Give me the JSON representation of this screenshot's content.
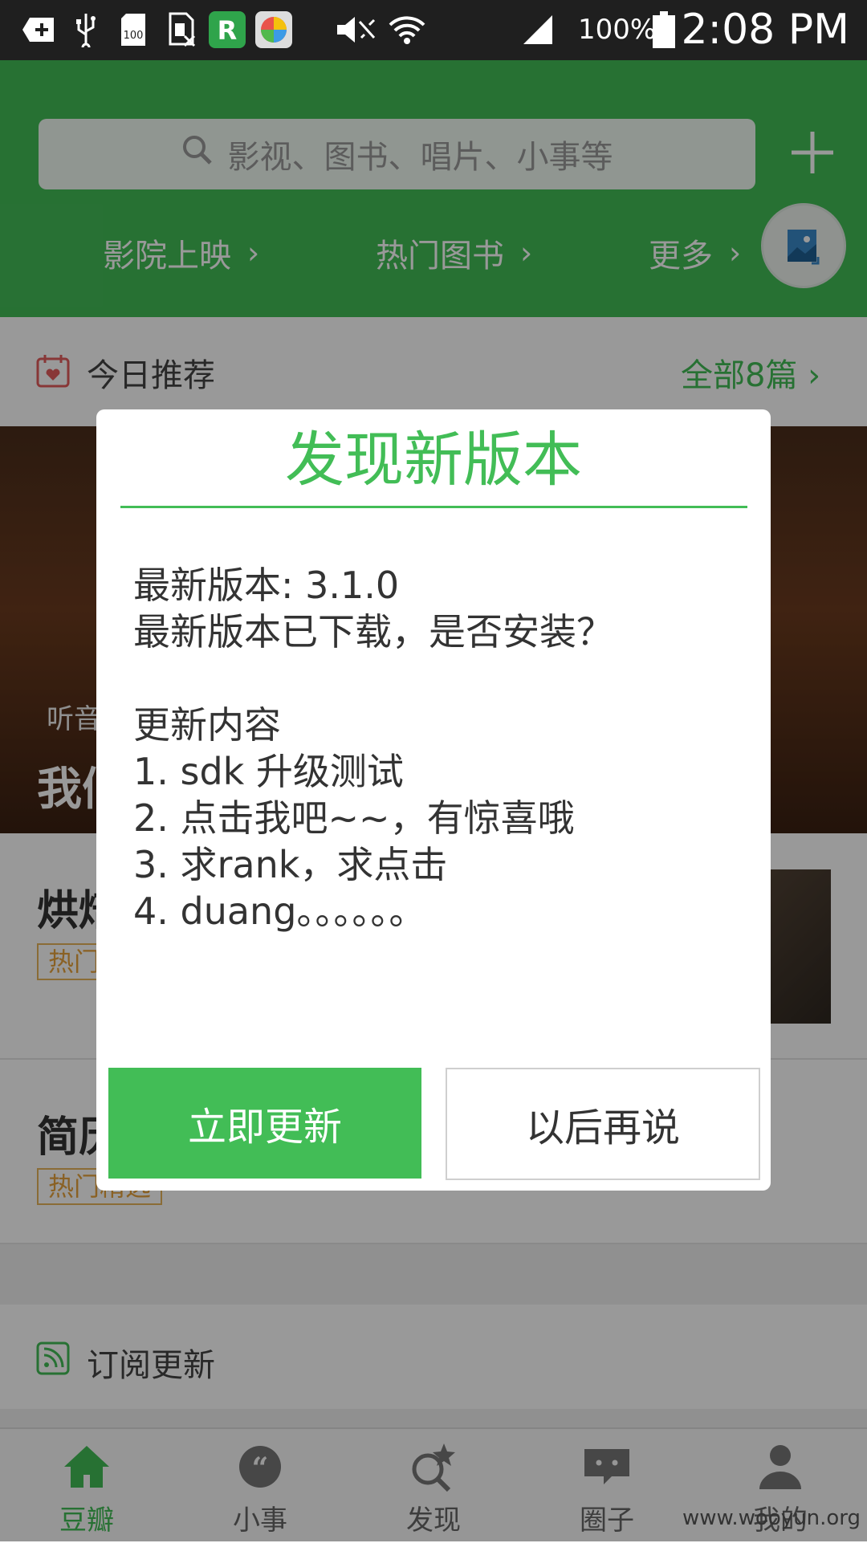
{
  "status_bar": {
    "battery_percent": "100%",
    "time": "2:08 PM",
    "icons": [
      "add-box-icon",
      "usb-icon",
      "sdcard-icon",
      "sim-off-icon",
      "renren-app-icon",
      "colorful-app-icon",
      "mute-icon",
      "wifi-icon",
      "signal-icon",
      "battery-icon"
    ],
    "sd_label": "100"
  },
  "header": {
    "search_placeholder": "影视、图书、唱片、小事等",
    "quick_links": [
      "影院上映",
      "热门图书",
      "更多"
    ]
  },
  "content": {
    "recommend_title": "今日推荐",
    "recommend_all": "全部8篇",
    "hero_subtitle": "听音",
    "hero_title": "我们",
    "cards": [
      {
        "title": "烘焙",
        "tag": "热门"
      },
      {
        "title": "简历",
        "tag": "热门精选"
      }
    ],
    "subscribe_title": "订阅更新"
  },
  "dialog": {
    "title": "发现新版本",
    "lines": [
      "最新版本: 3.1.0",
      "最新版本已下载，是否安装？",
      "",
      "更新内容",
      "1. sdk 升级测试",
      "2. 点击我吧~~，有惊喜哦",
      "3. 求rank，求点击",
      "4. duang。。。。。。"
    ],
    "update_button": "立即更新",
    "later_button": "以后再说"
  },
  "bottom_nav": {
    "items": [
      {
        "label": "豆瓣",
        "icon": "home-icon",
        "active": true
      },
      {
        "label": "小事",
        "icon": "quote-bubble-icon",
        "active": false
      },
      {
        "label": "发现",
        "icon": "discover-search-icon",
        "active": false
      },
      {
        "label": "圈子",
        "icon": "chat-bubble-icon",
        "active": false
      },
      {
        "label": "我的",
        "icon": "user-icon",
        "active": false
      }
    ]
  },
  "watermark": "www.wooyun.org",
  "colors": {
    "brand_green": "#42bd56",
    "tag_orange": "#e6a23c",
    "status_bar": "#1f1f1f"
  }
}
